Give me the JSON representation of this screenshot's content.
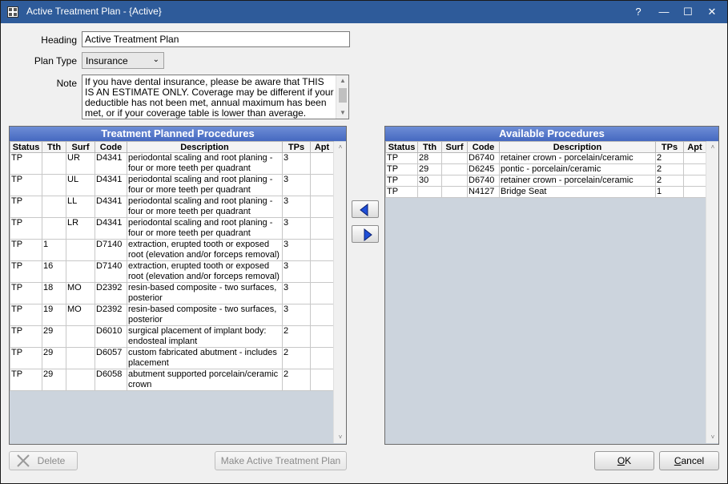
{
  "window": {
    "title": "Active Treatment Plan - {Active}",
    "help_label": "?",
    "minimize_label": "—",
    "maximize_label": "☐",
    "close_label": "✕"
  },
  "form": {
    "heading_label": "Heading",
    "heading_value": "Active Treatment Plan",
    "plan_type_label": "Plan Type",
    "plan_type_value": "Insurance",
    "note_label": "Note",
    "note_value": "If you have dental insurance, please be aware that THIS IS AN ESTIMATE ONLY.  Coverage may be different if your deductible has not been met, annual maximum has been met, or if your coverage table is lower than average."
  },
  "planned": {
    "title": "Treatment Planned Procedures",
    "columns": [
      "Status",
      "Tth",
      "Surf",
      "Code",
      "Description",
      "TPs",
      "Apt"
    ],
    "rows": [
      [
        "TP",
        "",
        "UR",
        "D4341",
        "periodontal scaling and root planing - four or more teeth per quadrant",
        "3",
        ""
      ],
      [
        "TP",
        "",
        "UL",
        "D4341",
        "periodontal scaling and root planing - four or more teeth per quadrant",
        "3",
        ""
      ],
      [
        "TP",
        "",
        "LL",
        "D4341",
        "periodontal scaling and root planing - four or more teeth per quadrant",
        "3",
        ""
      ],
      [
        "TP",
        "",
        "LR",
        "D4341",
        "periodontal scaling and root planing - four or more teeth per quadrant",
        "3",
        ""
      ],
      [
        "TP",
        "1",
        "",
        "D7140",
        "extraction, erupted tooth or exposed root (elevation and/or forceps removal)",
        "3",
        ""
      ],
      [
        "TP",
        "16",
        "",
        "D7140",
        "extraction, erupted tooth or exposed root (elevation and/or forceps removal)",
        "3",
        ""
      ],
      [
        "TP",
        "18",
        "MO",
        "D2392",
        "resin-based composite - two surfaces, posterior",
        "3",
        ""
      ],
      [
        "TP",
        "19",
        "MO",
        "D2392",
        "resin-based composite - two surfaces, posterior",
        "3",
        ""
      ],
      [
        "TP",
        "29",
        "",
        "D6010",
        "surgical placement of implant body: endosteal implant",
        "2",
        ""
      ],
      [
        "TP",
        "29",
        "",
        "D6057",
        "custom fabricated abutment - includes placement",
        "2",
        ""
      ],
      [
        "TP",
        "29",
        "",
        "D6058",
        "abutment supported porcelain/ceramic crown",
        "2",
        ""
      ]
    ]
  },
  "available": {
    "title": "Available Procedures",
    "columns": [
      "Status",
      "Tth",
      "Surf",
      "Code",
      "Description",
      "TPs",
      "Apt"
    ],
    "rows": [
      [
        "TP",
        "28",
        "",
        "D6740",
        "retainer crown - porcelain/ceramic",
        "2",
        ""
      ],
      [
        "TP",
        "29",
        "",
        "D6245",
        "pontic - porcelain/ceramic",
        "2",
        ""
      ],
      [
        "TP",
        "30",
        "",
        "D6740",
        "retainer crown - porcelain/ceramic",
        "2",
        ""
      ],
      [
        "TP",
        "",
        "",
        "N4127",
        "Bridge Seat",
        "1",
        ""
      ]
    ]
  },
  "buttons": {
    "delete": "Delete",
    "make_active": "Make Active Treatment Plan",
    "ok_u": "O",
    "ok_rest": "K",
    "cancel_u": "C",
    "cancel_rest": "ancel"
  },
  "icons": {
    "move_left": "arrow-left-icon",
    "move_right": "arrow-right-icon",
    "delete": "x-icon"
  },
  "colors": {
    "titlebar": "#2e5b9a",
    "panel_header": "#4568c0",
    "arrow_blue": "#1f4fd8"
  }
}
